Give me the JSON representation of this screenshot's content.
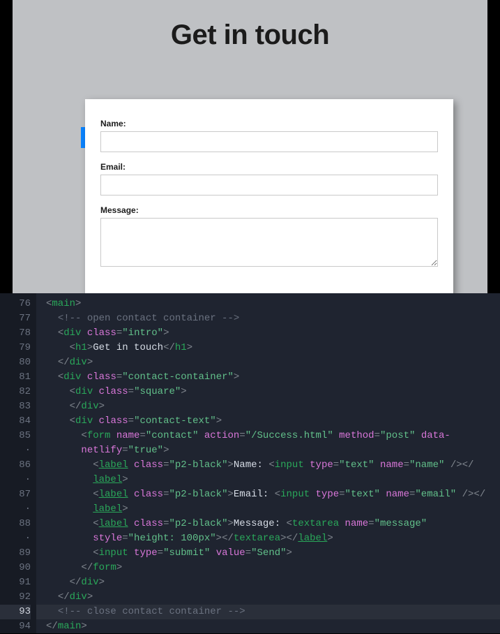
{
  "preview": {
    "heading": "Get in touch",
    "labels": {
      "name": "Name:",
      "email": "Email:",
      "message": "Message:"
    }
  },
  "editor": {
    "gutter": [
      "76",
      "77",
      "78",
      "79",
      "80",
      "81",
      "82",
      "83",
      "84",
      "85",
      "·",
      "86",
      "·",
      "87",
      "·",
      "88",
      "·",
      "89",
      "90",
      "91",
      "92",
      "93",
      "94"
    ],
    "highlighted_line_index": 21,
    "lines": [
      {
        "indent": 0,
        "tokens": [
          [
            "punc",
            "<"
          ],
          [
            "tag",
            "main"
          ],
          [
            "punc",
            ">"
          ]
        ]
      },
      {
        "indent": 1,
        "tokens": [
          [
            "cmt",
            "<!-- open contact container -->"
          ]
        ]
      },
      {
        "indent": 1,
        "tokens": [
          [
            "punc",
            "<"
          ],
          [
            "tag",
            "div"
          ],
          [
            "txt",
            " "
          ],
          [
            "attr",
            "class"
          ],
          [
            "punc",
            "="
          ],
          [
            "str",
            "\"intro\""
          ],
          [
            "punc",
            ">"
          ]
        ]
      },
      {
        "indent": 2,
        "tokens": [
          [
            "punc",
            "<"
          ],
          [
            "tag",
            "h1"
          ],
          [
            "punc",
            ">"
          ],
          [
            "txt",
            "Get in touch"
          ],
          [
            "punc",
            "</"
          ],
          [
            "tag",
            "h1"
          ],
          [
            "punc",
            ">"
          ]
        ]
      },
      {
        "indent": 1,
        "tokens": [
          [
            "punc",
            "</"
          ],
          [
            "tag",
            "div"
          ],
          [
            "punc",
            ">"
          ]
        ]
      },
      {
        "indent": 1,
        "tokens": [
          [
            "punc",
            "<"
          ],
          [
            "tag",
            "div"
          ],
          [
            "txt",
            " "
          ],
          [
            "attr",
            "class"
          ],
          [
            "punc",
            "="
          ],
          [
            "str",
            "\"contact-container\""
          ],
          [
            "punc",
            ">"
          ]
        ]
      },
      {
        "indent": 2,
        "tokens": [
          [
            "punc",
            "<"
          ],
          [
            "tag",
            "div"
          ],
          [
            "txt",
            " "
          ],
          [
            "attr",
            "class"
          ],
          [
            "punc",
            "="
          ],
          [
            "str",
            "\"square\""
          ],
          [
            "punc",
            ">"
          ]
        ]
      },
      {
        "indent": 2,
        "tokens": [
          [
            "punc",
            "</"
          ],
          [
            "tag",
            "div"
          ],
          [
            "punc",
            ">"
          ]
        ]
      },
      {
        "indent": 2,
        "tokens": [
          [
            "punc",
            "<"
          ],
          [
            "tag",
            "div"
          ],
          [
            "txt",
            " "
          ],
          [
            "attr",
            "class"
          ],
          [
            "punc",
            "="
          ],
          [
            "str",
            "\"contact-text\""
          ],
          [
            "punc",
            ">"
          ]
        ]
      },
      {
        "indent": 3,
        "tokens": [
          [
            "punc",
            "<"
          ],
          [
            "tag",
            "form"
          ],
          [
            "txt",
            " "
          ],
          [
            "attr",
            "name"
          ],
          [
            "punc",
            "="
          ],
          [
            "str",
            "\"contact\""
          ],
          [
            "txt",
            " "
          ],
          [
            "attr",
            "action"
          ],
          [
            "punc",
            "="
          ],
          [
            "str",
            "\"/Success.html\""
          ],
          [
            "txt",
            " "
          ],
          [
            "attr",
            "method"
          ],
          [
            "punc",
            "="
          ],
          [
            "str",
            "\"post\""
          ],
          [
            "txt",
            " "
          ],
          [
            "attr",
            "data-"
          ]
        ]
      },
      {
        "indent": 3,
        "tokens": [
          [
            "attr",
            "netlify"
          ],
          [
            "punc",
            "="
          ],
          [
            "str",
            "\"true\""
          ],
          [
            "punc",
            ">"
          ]
        ]
      },
      {
        "indent": 4,
        "tokens": [
          [
            "punc",
            "<"
          ],
          [
            "tag und",
            "label"
          ],
          [
            "txt",
            " "
          ],
          [
            "attr",
            "class"
          ],
          [
            "punc",
            "="
          ],
          [
            "str",
            "\"p2-black\""
          ],
          [
            "punc",
            ">"
          ],
          [
            "txt",
            "Name: "
          ],
          [
            "punc",
            "<"
          ],
          [
            "tag",
            "input"
          ],
          [
            "txt",
            " "
          ],
          [
            "attr",
            "type"
          ],
          [
            "punc",
            "="
          ],
          [
            "str",
            "\"text\""
          ],
          [
            "txt",
            " "
          ],
          [
            "attr",
            "name"
          ],
          [
            "punc",
            "="
          ],
          [
            "str",
            "\"name\""
          ],
          [
            "txt",
            " "
          ],
          [
            "punc",
            "/></"
          ]
        ]
      },
      {
        "indent": 4,
        "tokens": [
          [
            "tag und",
            "label"
          ],
          [
            "punc",
            ">"
          ]
        ]
      },
      {
        "indent": 4,
        "tokens": [
          [
            "punc",
            "<"
          ],
          [
            "tag und",
            "label"
          ],
          [
            "txt",
            " "
          ],
          [
            "attr",
            "class"
          ],
          [
            "punc",
            "="
          ],
          [
            "str",
            "\"p2-black\""
          ],
          [
            "punc",
            ">"
          ],
          [
            "txt",
            "Email: "
          ],
          [
            "punc",
            "<"
          ],
          [
            "tag",
            "input"
          ],
          [
            "txt",
            " "
          ],
          [
            "attr",
            "type"
          ],
          [
            "punc",
            "="
          ],
          [
            "str",
            "\"text\""
          ],
          [
            "txt",
            " "
          ],
          [
            "attr",
            "name"
          ],
          [
            "punc",
            "="
          ],
          [
            "str",
            "\"email\""
          ],
          [
            "txt",
            " "
          ],
          [
            "punc",
            "/></"
          ]
        ]
      },
      {
        "indent": 4,
        "tokens": [
          [
            "tag und",
            "label"
          ],
          [
            "punc",
            ">"
          ]
        ]
      },
      {
        "indent": 4,
        "tokens": [
          [
            "punc",
            "<"
          ],
          [
            "tag und",
            "label"
          ],
          [
            "txt",
            " "
          ],
          [
            "attr",
            "class"
          ],
          [
            "punc",
            "="
          ],
          [
            "str",
            "\"p2-black\""
          ],
          [
            "punc",
            ">"
          ],
          [
            "txt",
            "Message: "
          ],
          [
            "punc",
            "<"
          ],
          [
            "tag",
            "textarea"
          ],
          [
            "txt",
            " "
          ],
          [
            "attr",
            "name"
          ],
          [
            "punc",
            "="
          ],
          [
            "str",
            "\"message\""
          ],
          [
            "txt",
            " "
          ]
        ]
      },
      {
        "indent": 4,
        "tokens": [
          [
            "attr",
            "style"
          ],
          [
            "punc",
            "="
          ],
          [
            "str",
            "\"height: 100px\""
          ],
          [
            "punc",
            "></"
          ],
          [
            "tag",
            "textarea"
          ],
          [
            "punc",
            "></"
          ],
          [
            "tag und",
            "label"
          ],
          [
            "punc",
            ">"
          ]
        ]
      },
      {
        "indent": 4,
        "tokens": [
          [
            "punc",
            "<"
          ],
          [
            "tag",
            "input"
          ],
          [
            "txt",
            " "
          ],
          [
            "attr",
            "type"
          ],
          [
            "punc",
            "="
          ],
          [
            "str",
            "\"submit\""
          ],
          [
            "txt",
            " "
          ],
          [
            "attr",
            "value"
          ],
          [
            "punc",
            "="
          ],
          [
            "str",
            "\"Send\""
          ],
          [
            "punc",
            ">"
          ]
        ]
      },
      {
        "indent": 3,
        "tokens": [
          [
            "punc",
            "</"
          ],
          [
            "tag",
            "form"
          ],
          [
            "punc",
            ">"
          ]
        ]
      },
      {
        "indent": 2,
        "tokens": [
          [
            "punc",
            "</"
          ],
          [
            "tag",
            "div"
          ],
          [
            "punc",
            ">"
          ]
        ]
      },
      {
        "indent": 1,
        "tokens": [
          [
            "punc",
            "</"
          ],
          [
            "tag",
            "div"
          ],
          [
            "punc",
            ">"
          ]
        ]
      },
      {
        "indent": 1,
        "tokens": [
          [
            "cmt",
            "<!-- close contact container -->"
          ]
        ]
      },
      {
        "indent": 0,
        "tokens": [
          [
            "punc",
            "</"
          ],
          [
            "tag",
            "main"
          ],
          [
            "punc",
            ">"
          ]
        ]
      }
    ]
  }
}
